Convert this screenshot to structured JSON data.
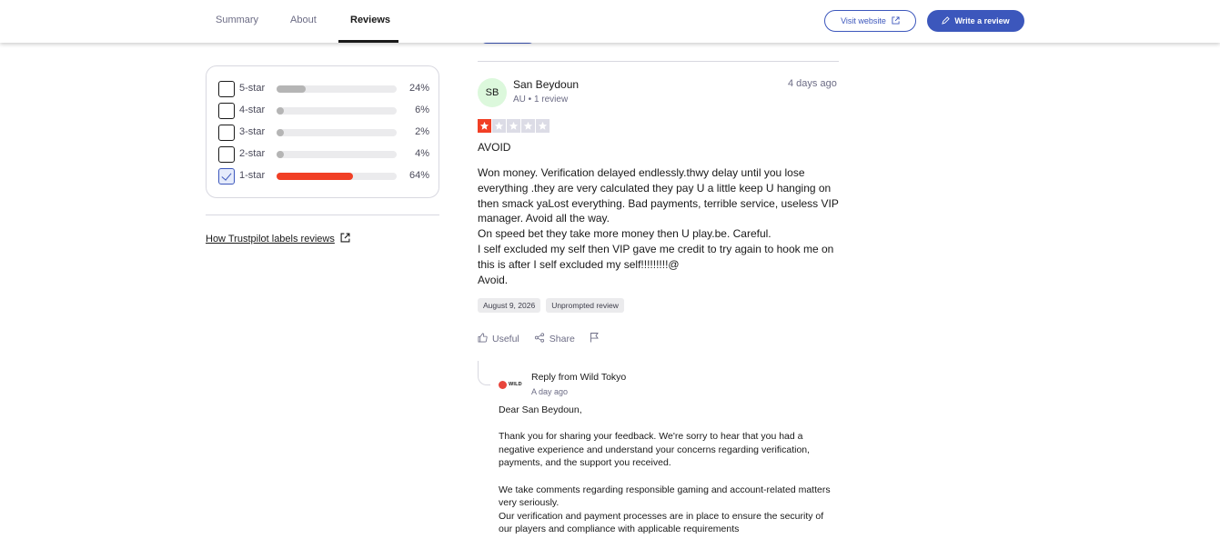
{
  "nav": {
    "tabs": [
      {
        "label": "Summary",
        "active": false
      },
      {
        "label": "About",
        "active": false
      },
      {
        "label": "Reviews",
        "active": true
      }
    ],
    "visit_website": "Visit website",
    "write_review": "Write a review"
  },
  "filters": {
    "rows": [
      {
        "label": "5-star",
        "percent": "24%",
        "value": 24,
        "checked": false
      },
      {
        "label": "4-star",
        "percent": "6%",
        "value": 6,
        "checked": false
      },
      {
        "label": "3-star",
        "percent": "2%",
        "value": 2,
        "checked": false
      },
      {
        "label": "2-star",
        "percent": "4%",
        "value": 4,
        "checked": false
      },
      {
        "label": "1-star",
        "percent": "64%",
        "value": 64,
        "checked": true
      }
    ],
    "how_link": "How Trustpilot labels reviews"
  },
  "review": {
    "initials": "SB",
    "name": "San Beydoun",
    "meta": "AU • 1 review",
    "date": "4 days ago",
    "rating": 1,
    "title": "AVOID",
    "body": [
      "Won money. Verification delayed endlessly.thwy delay until you lose everything .they are very calculated they pay U a little keep U hanging on then smack yaLost everything. Bad payments, terrible service, useless VIP manager. Avoid all the way.",
      "On speed bet they take more money then U play.be. Careful.",
      "I self excluded my self then VIP gave me credit to try again to hook me on this is after I self excluded my self!!!!!!!!!@",
      "Avoid."
    ],
    "experience_date": "August 9, 2026",
    "tag": "Unprompted review",
    "actions": {
      "useful": "Useful",
      "share": "Share"
    }
  },
  "reply": {
    "logo_text": "WILD",
    "from": "Reply from Wild Tokyo",
    "date": "A day ago",
    "greeting": "Dear San Beydoun,",
    "para1": "Thank you for sharing your feedback. We're sorry to hear that you had a negative experience and understand your concerns regarding verification, payments, and the support you received.",
    "para2": "We take comments regarding responsible gaming and account-related matters very seriously.",
    "para3": "Our verification and payment processes are in place to ensure the security of our players and compliance with applicable requirements"
  },
  "colors": {
    "accent": "#3c57bc",
    "star_red": "#f13f25",
    "avatar_bg": "#dcf8dc"
  }
}
